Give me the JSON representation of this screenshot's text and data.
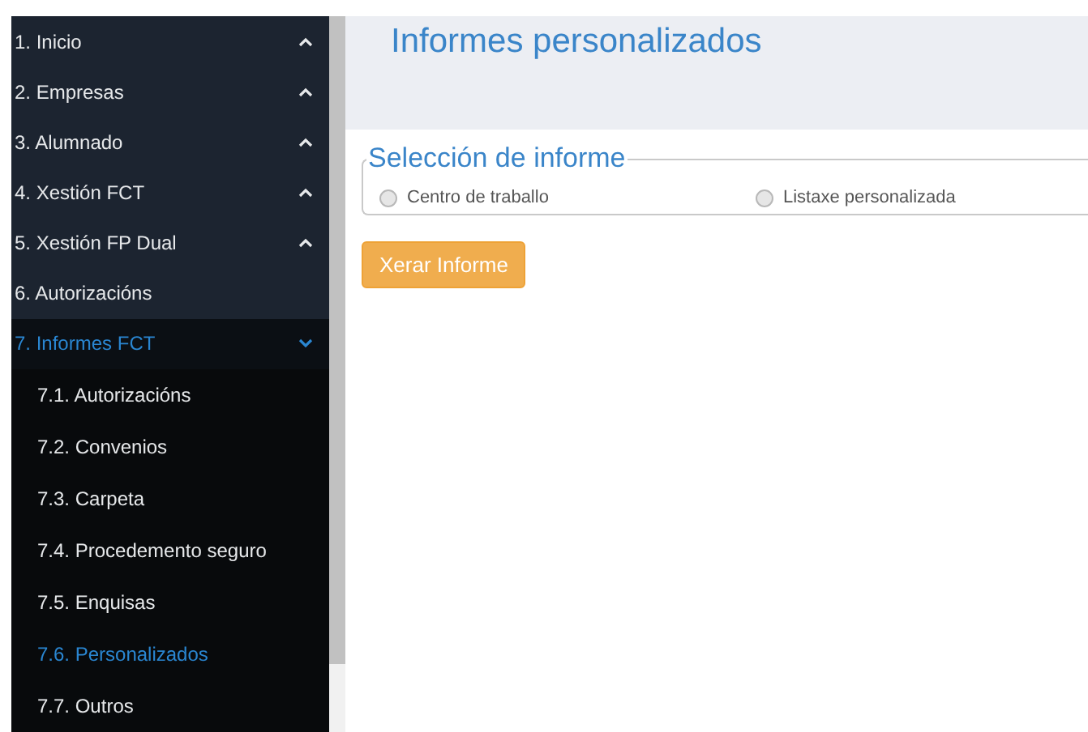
{
  "sidebar": {
    "items": [
      {
        "label": "1. Inicio",
        "expanded": false,
        "selected": false
      },
      {
        "label": "2. Empresas",
        "expanded": false,
        "selected": false
      },
      {
        "label": "3. Alumnado",
        "expanded": false,
        "selected": false
      },
      {
        "label": "4. Xestión FCT",
        "expanded": false,
        "selected": false
      },
      {
        "label": "5. Xestión FP Dual",
        "expanded": false,
        "selected": false
      },
      {
        "label": "6. Autorizacións",
        "selected": false
      },
      {
        "label": "7. Informes FCT",
        "expanded": true,
        "selected": true,
        "children": [
          {
            "label": "7.1. Autorizacións",
            "selected": false
          },
          {
            "label": "7.2. Convenios",
            "selected": false
          },
          {
            "label": "7.3. Carpeta",
            "selected": false
          },
          {
            "label": "7.4. Procedemento seguro",
            "selected": false
          },
          {
            "label": "7.5. Enquisas",
            "selected": false
          },
          {
            "label": "7.6. Personalizados",
            "selected": true
          },
          {
            "label": "7.7. Outros",
            "selected": false
          }
        ]
      }
    ]
  },
  "page": {
    "title": "Informes personalizados"
  },
  "report_selection": {
    "legend": "Selección de informe",
    "options": [
      {
        "label": "Centro de traballo",
        "checked": false
      },
      {
        "label": "Listaxe personalizada",
        "checked": false
      }
    ]
  },
  "button": "Xerar Informe"
}
